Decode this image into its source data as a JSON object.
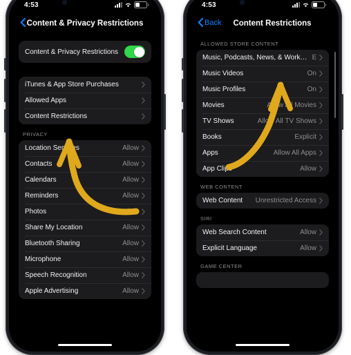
{
  "meta": {
    "accent_blue": "#0a84ff",
    "arrow_color": "#e0a81c",
    "toggle_green": "#32d74b",
    "card_bg": "#1c1c1e"
  },
  "phone_left": {
    "status": {
      "time": "4:53",
      "cellular": "signal-bars",
      "wifi": "wifi",
      "battery": "battery-low"
    },
    "nav": {
      "back_label": "",
      "title": "Content & Privacy Restrictions"
    },
    "toggle_row": {
      "label": "Content & Privacy Restrictions",
      "state": "on"
    },
    "group_main": [
      {
        "label": "iTunes & App Store Purchases",
        "value": ""
      },
      {
        "label": "Allowed Apps",
        "value": ""
      },
      {
        "label": "Content Restrictions",
        "value": ""
      }
    ],
    "privacy_header": "PRIVACY",
    "group_privacy": [
      {
        "label": "Location Services",
        "value": "Allow"
      },
      {
        "label": "Contacts",
        "value": "Allow"
      },
      {
        "label": "Calendars",
        "value": "Allow"
      },
      {
        "label": "Reminders",
        "value": "Allow"
      },
      {
        "label": "Photos",
        "value": "Allow"
      },
      {
        "label": "Share My Location",
        "value": "Allow"
      },
      {
        "label": "Bluetooth Sharing",
        "value": "Allow"
      },
      {
        "label": "Microphone",
        "value": "Allow"
      },
      {
        "label": "Speech Recognition",
        "value": "Allow"
      },
      {
        "label": "Apple Advertising",
        "value": "Allow"
      }
    ]
  },
  "phone_right": {
    "status": {
      "time": "4:53",
      "cellular": "signal-bars",
      "wifi": "wifi",
      "battery": "battery-low"
    },
    "nav": {
      "back_label": "Back",
      "title": "Content Restrictions"
    },
    "header_store": "ALLOWED STORE CONTENT",
    "group_store": [
      {
        "label": "Music, Podcasts, News, & Workouts",
        "value": "E"
      },
      {
        "label": "Music Videos",
        "value": "On"
      },
      {
        "label": "Music Profiles",
        "value": "On"
      },
      {
        "label": "Movies",
        "value": "Allow All Movies"
      },
      {
        "label": "TV Shows",
        "value": "Allow All TV Shows"
      },
      {
        "label": "Books",
        "value": "Explicit"
      },
      {
        "label": "Apps",
        "value": "Allow All Apps"
      },
      {
        "label": "App Clips",
        "value": "Allow"
      }
    ],
    "header_web": "WEB CONTENT",
    "group_web": [
      {
        "label": "Web Content",
        "value": "Unrestricted Access"
      }
    ],
    "header_siri": "SIRI",
    "group_siri": [
      {
        "label": "Web Search Content",
        "value": "Allow"
      },
      {
        "label": "Explicit Language",
        "value": "Allow"
      }
    ],
    "header_game": "GAME CENTER"
  }
}
